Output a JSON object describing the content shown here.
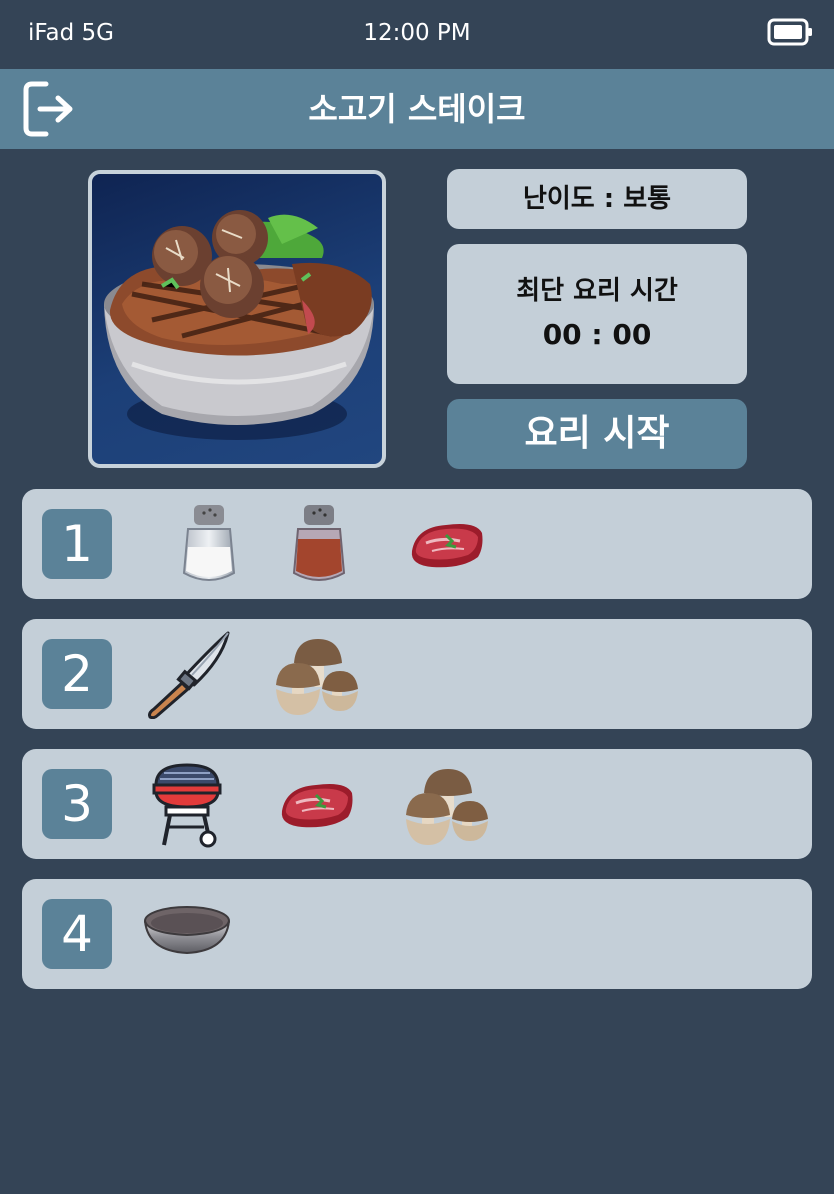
{
  "status_bar": {
    "carrier": "iFad 5G",
    "time": "12:00 PM"
  },
  "header": {
    "title": "소고기 스테이크",
    "exit_icon": "logout-icon"
  },
  "dish": {
    "image_icon": "beef-steak-bowl-image"
  },
  "info": {
    "difficulty": "난이도 : 보통",
    "best_time_label": "최단 요리 시간",
    "best_time_value": "00 : 00"
  },
  "start_button": {
    "label": "요리 시작"
  },
  "steps": [
    {
      "number": "1",
      "ingredients": [
        "salt-shaker-icon",
        "pepper-shaker-icon",
        "raw-beef-icon"
      ]
    },
    {
      "number": "2",
      "ingredients": [
        "knife-icon",
        "mushroom-icon"
      ]
    },
    {
      "number": "3",
      "ingredients": [
        "grill-icon",
        "raw-beef-icon",
        "mushroom-icon"
      ]
    },
    {
      "number": "4",
      "ingredients": [
        "bowl-icon"
      ]
    }
  ],
  "colors": {
    "background": "#344456",
    "header": "#5b8298",
    "panel": "#c4cfd8",
    "accent": "#5b8298"
  }
}
